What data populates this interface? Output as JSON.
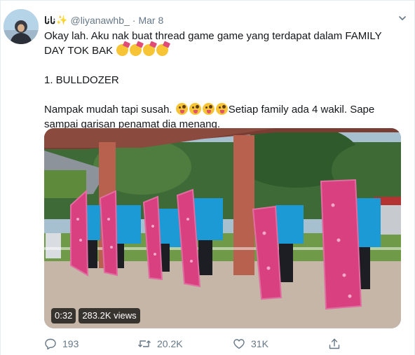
{
  "tweet": {
    "author": {
      "display_name": "نانا",
      "display_emoji": "✨",
      "handle": "@liyanawhb_",
      "separator": "·",
      "date": "Mar 8"
    },
    "text": {
      "line1": "Okay lah. Aku nak buat thread game game yang terdapat dalam FAMILY DAY TOK BAK",
      "heading": "1. BULLDOZER",
      "body": "Nampak mudah tapi susah.",
      "body_rest": "Setiap family ada 4 wakil. Sape sampai garisan penamat dia menang."
    },
    "emojis": {
      "line1": [
        "party-face",
        "party-face",
        "party-face",
        "party-face"
      ],
      "body": [
        "zany-face",
        "zany-face",
        "zany-face",
        "zany-face"
      ]
    },
    "media": {
      "duration": "0:32",
      "views": "283.2K views"
    },
    "actions": {
      "reply_count": "193",
      "retweet_count": "20.2K",
      "like_count": "31K"
    },
    "icons": {
      "more": "chevron-down-icon",
      "reply": "reply-icon",
      "retweet": "retweet-icon",
      "like": "heart-icon",
      "share": "share-icon"
    }
  },
  "colors": {
    "secondary_text": "#657786",
    "primary_text": "#14171a",
    "border": "#e6ecf0"
  }
}
